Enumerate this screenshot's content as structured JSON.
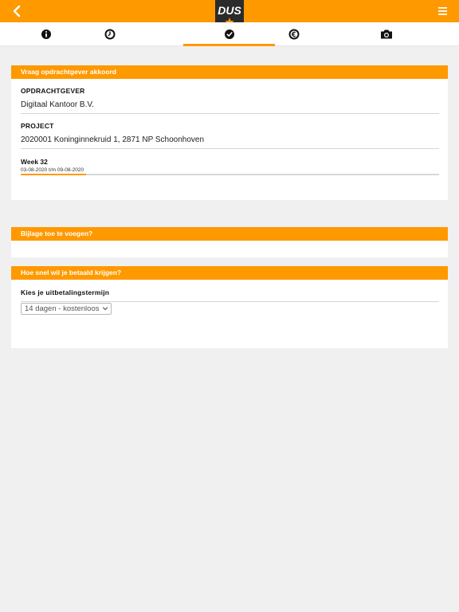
{
  "app": {
    "logo_text": "DUS"
  },
  "tabs": [
    {
      "id": "info",
      "icon": "info-icon"
    },
    {
      "id": "time",
      "icon": "clock-icon"
    },
    {
      "id": "approve",
      "icon": "check-circle-icon",
      "active": true
    },
    {
      "id": "expenses",
      "icon": "euro-icon"
    },
    {
      "id": "photo",
      "icon": "camera-icon"
    }
  ],
  "approval": {
    "header": "Vraag opdrachtgever akkoord",
    "client_label": "OPDRACHTGEVER",
    "client_value": "Digitaal Kantoor B.V.",
    "project_label": "PROJECT",
    "project_value": "2020001 Koninginnekruid 1, 2871 NP Schoonhoven",
    "week_label": "Week 32",
    "week_range": "03-08-2020 t/m 09-08-2020"
  },
  "attachment": {
    "header": "Bijlage toe te voegen?"
  },
  "payment": {
    "header": "Hoe snel wil je betaald krijgen?",
    "term_label": "Kies je uitbetalingstermijn",
    "term_selected": "14 dagen - kostenloos"
  },
  "colors": {
    "accent": "#ff9900",
    "background": "#f0f0f0",
    "logo_shield": "#2b2b2b"
  }
}
